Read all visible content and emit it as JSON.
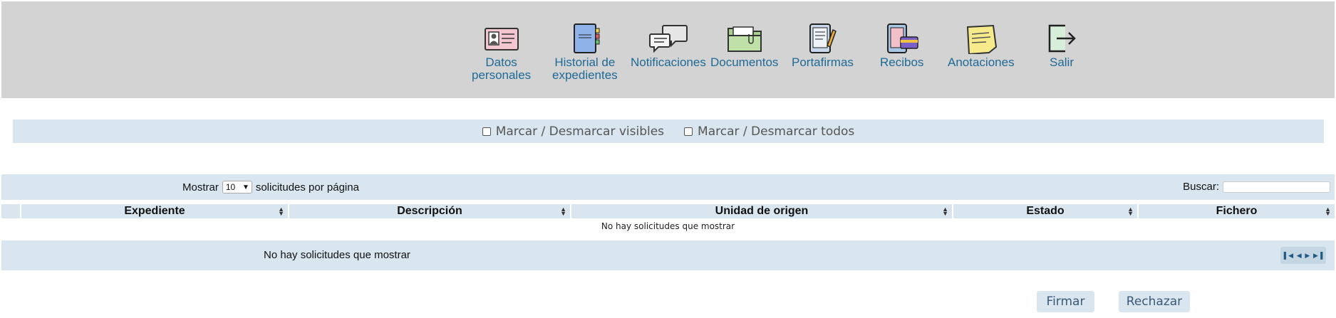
{
  "nav": {
    "items": [
      {
        "label": "Datos\npersonales",
        "icon": "id-card-icon"
      },
      {
        "label": "Historial de\nexpedientes",
        "icon": "notebook-icon"
      },
      {
        "label": "Notificaciones",
        "icon": "speech-bubbles-icon"
      },
      {
        "label": "Documentos",
        "icon": "folder-icon"
      },
      {
        "label": "Portafirmas",
        "icon": "tablet-pen-icon"
      },
      {
        "label": "Recibos",
        "icon": "phone-card-icon"
      },
      {
        "label": "Anotaciones",
        "icon": "sticky-note-icon"
      },
      {
        "label": "Salir",
        "icon": "exit-icon"
      }
    ]
  },
  "filters": {
    "visible_label": "Marcar / Desmarcar visibles",
    "all_label": "Marcar / Desmarcar todos"
  },
  "table_controls": {
    "show_label": "Mostrar",
    "page_size": "10",
    "per_page_label": "solicitudes por página",
    "search_label": "Buscar:",
    "search_value": ""
  },
  "table": {
    "columns": [
      "Expediente",
      "Descripción",
      "Unidad de origen",
      "Estado",
      "Fichero"
    ],
    "empty_message": "No hay solicitudes que mostrar"
  },
  "footer": {
    "info": "No hay solicitudes que mostrar",
    "pager_icons": [
      "first-page-icon",
      "prev-page-icon",
      "next-page-icon",
      "last-page-icon"
    ]
  },
  "actions": {
    "sign_label": "Firmar",
    "reject_label": "Rechazar"
  },
  "colors": {
    "topbar": "#d3d3d3",
    "panel": "#d9e6ef",
    "link": "#1f6a96"
  }
}
